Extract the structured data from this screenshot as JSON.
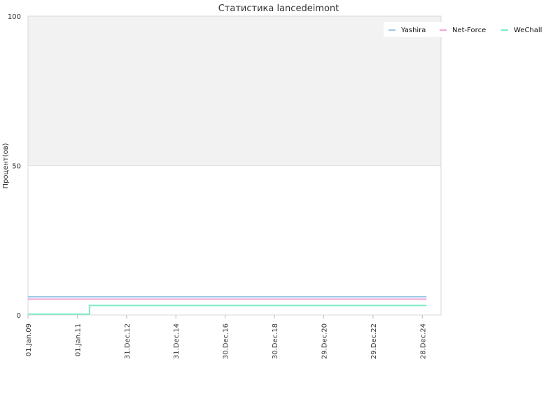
{
  "chart_data": {
    "type": "line",
    "title": "Статистика lancedeimont",
    "xlabel": "",
    "ylabel": "Процент(ов)",
    "ylim": [
      0,
      100
    ],
    "y_ticks": [
      "0",
      "50",
      "100"
    ],
    "x_ticks": [
      "01.Jan.09",
      "01.Jan.11",
      "31.Dec.12",
      "31.Dec.14",
      "30.Dec.16",
      "30.Dec.18",
      "29.Dec.20",
      "29.Dec.22",
      "28.Dec.24"
    ],
    "xlim": [
      "2009-01-01",
      "2025-10-01"
    ],
    "grid": true,
    "upper_band_color": "#f2f2f2",
    "legend_position": "top-right",
    "series": [
      {
        "name": "Yashira",
        "color": "#9ec9e8",
        "step": true,
        "points": [
          [
            "2009-01-01",
            6.1
          ],
          [
            "2025-03-01",
            6.1
          ]
        ]
      },
      {
        "name": "Net-Force",
        "color": "#efa9d7",
        "step": true,
        "points": [
          [
            "2009-01-01",
            5.3
          ],
          [
            "2025-03-01",
            5.3
          ]
        ]
      },
      {
        "name": "WeChall",
        "color": "#7eecc6",
        "step": true,
        "points": [
          [
            "2009-01-01",
            0.3
          ],
          [
            "2011-07-01",
            3.2
          ],
          [
            "2025-03-01",
            3.2
          ]
        ]
      }
    ]
  }
}
